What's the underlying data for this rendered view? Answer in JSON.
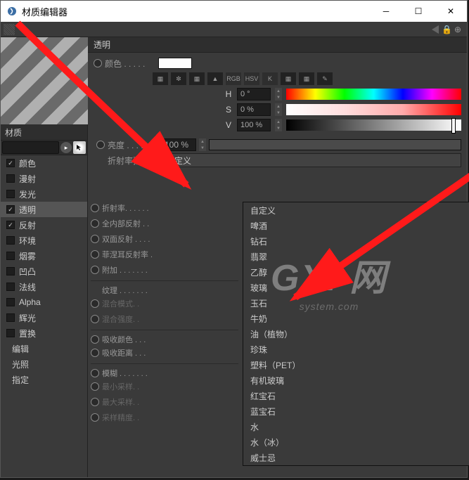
{
  "window": {
    "title": "材质编辑器"
  },
  "left": {
    "material_label": "材质",
    "channels": [
      {
        "label": "颜色",
        "checked": true,
        "active": false
      },
      {
        "label": "漫射",
        "checked": false,
        "active": false
      },
      {
        "label": "发光",
        "checked": false,
        "active": false
      },
      {
        "label": "透明",
        "checked": true,
        "active": true
      },
      {
        "label": "反射",
        "checked": true,
        "active": false
      },
      {
        "label": "环境",
        "checked": false,
        "active": false
      },
      {
        "label": "烟雾",
        "checked": false,
        "active": false
      },
      {
        "label": "凹凸",
        "checked": false,
        "active": false
      },
      {
        "label": "法线",
        "checked": false,
        "active": false
      },
      {
        "label": "Alpha",
        "checked": false,
        "active": false
      },
      {
        "label": "辉光",
        "checked": false,
        "active": false
      },
      {
        "label": "置换",
        "checked": false,
        "active": false
      }
    ],
    "sub_actions": [
      {
        "label": "编辑"
      },
      {
        "label": "光照"
      },
      {
        "label": "指定"
      }
    ]
  },
  "panel": {
    "section_title": "透明",
    "color_label": "颜色 . . . . .",
    "hsv": {
      "h_label": "H",
      "h_value": "0 °",
      "s_label": "S",
      "s_value": "0 %",
      "v_label": "V",
      "v_value": "100 %"
    },
    "brightness": {
      "label": "亮度 . . . . .",
      "value": "100 %"
    },
    "preset": {
      "label": "折射率预设 .",
      "selected": "自定义"
    },
    "under_rows": [
      {
        "label": "折射率. . . . . .",
        "radio": true,
        "sep": false
      },
      {
        "label": "全内部反射 . .",
        "radio": true,
        "sep": false
      },
      {
        "label": "双面反射 . . . .",
        "radio": true,
        "sep": false
      },
      {
        "label": "菲涅耳反射率 .",
        "radio": true,
        "sep": false
      },
      {
        "label": "附加 . . . . . . .",
        "radio": true,
        "sep": false
      },
      {
        "label": "纹理 . . . . . . .",
        "radio": false,
        "sep": true
      },
      {
        "label": "混合模式. .",
        "radio": true,
        "sep": false,
        "dim": true
      },
      {
        "label": "混合强度. .",
        "radio": true,
        "sep": false,
        "dim": true
      },
      {
        "label": "吸收颜色 . . .",
        "radio": true,
        "sep": true
      },
      {
        "label": "吸收距离 . . .",
        "radio": true,
        "sep": false
      },
      {
        "label": "模糊 . . . . . . .",
        "radio": true,
        "sep": true
      },
      {
        "label": "最小采样. .",
        "radio": true,
        "sep": false,
        "dim": true
      },
      {
        "label": "最大采样. .",
        "radio": true,
        "sep": false,
        "dim": true
      },
      {
        "label": "采样精度. .",
        "radio": true,
        "sep": false,
        "dim": true
      }
    ],
    "icon_btns": [
      "▦",
      "✼",
      "▦",
      "▲",
      "RGB",
      "HSV",
      "K",
      "▦",
      "▦",
      "✎"
    ]
  },
  "dropdown_options": [
    "自定义",
    "啤酒",
    "钻石",
    "翡翠",
    "乙醇",
    "玻璃",
    "玉石",
    "牛奶",
    "油（植物）",
    "珍珠",
    "塑料（PET）",
    "有机玻璃",
    "红宝石",
    "蓝宝石",
    "水",
    "水（冰）",
    "威士忌"
  ],
  "watermark": {
    "big": "GXI 网",
    "sm": "system.com"
  }
}
